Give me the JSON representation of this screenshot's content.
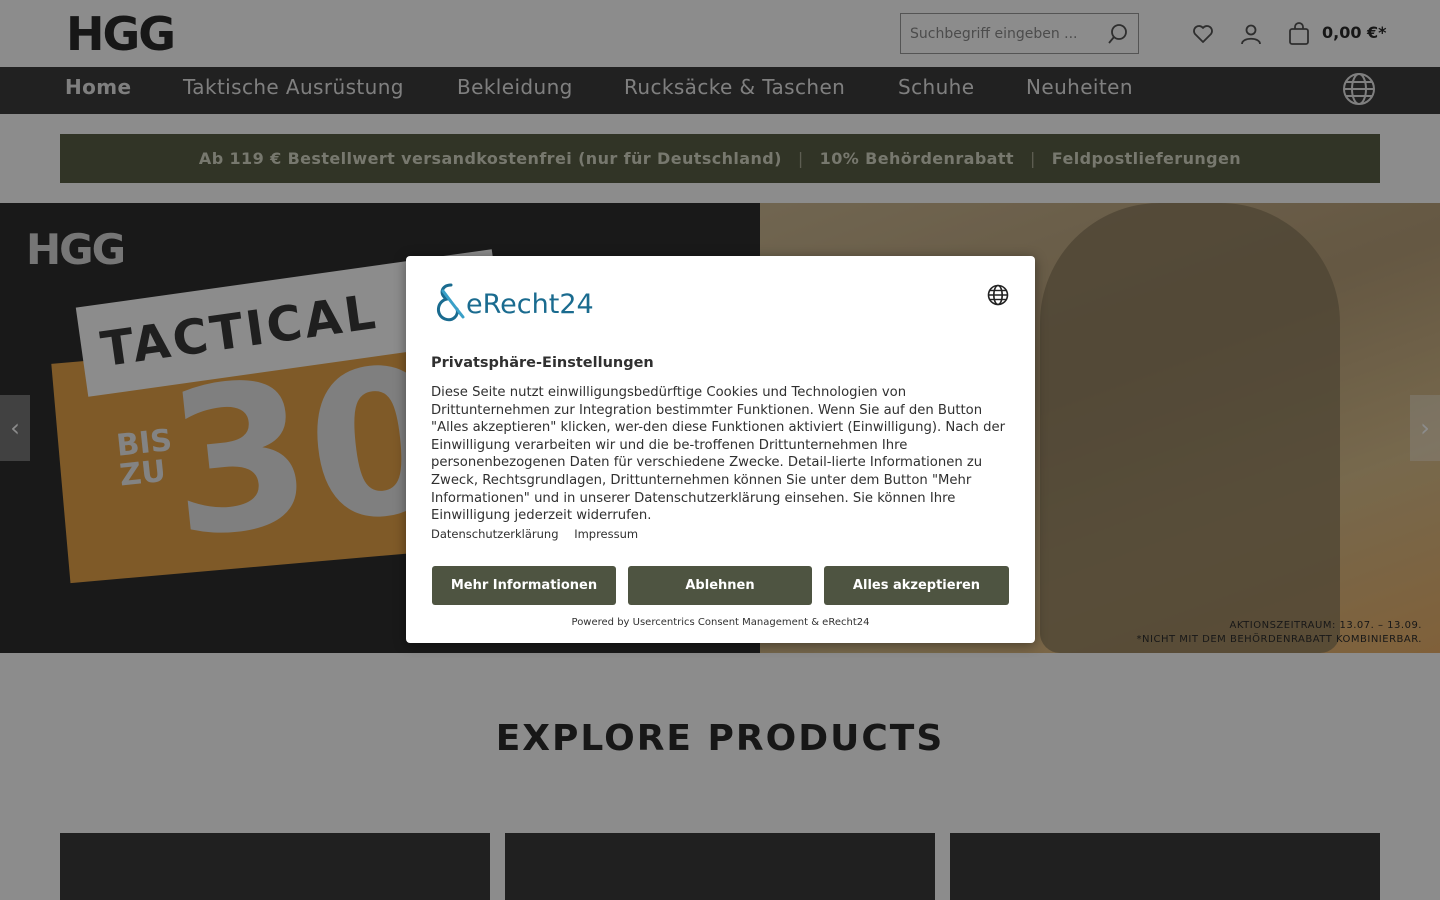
{
  "header": {
    "logo": "HGG",
    "search": {
      "placeholder": "Suchbegriff eingeben ..."
    },
    "icons": [
      "heart-icon",
      "user-icon",
      "shopping-bag-icon"
    ],
    "cart_total": "0,00 €*"
  },
  "nav": {
    "items": [
      {
        "label": "Home",
        "active": true
      },
      {
        "label": "Taktische Ausrüstung"
      },
      {
        "label": "Bekleidung"
      },
      {
        "label": "Rucksäcke & Taschen"
      },
      {
        "label": "Schuhe"
      },
      {
        "label": "Neuheiten"
      }
    ],
    "icon": "globe-icon"
  },
  "promo": {
    "items": [
      "Ab 119 € Bestellwert versandkostenfrei (nur für Deutschland)",
      "10% Behördenrabatt",
      "Feldpostlieferungen"
    ],
    "separator": "|"
  },
  "hero": {
    "logo": "HGG",
    "headline": "TACTICAL",
    "discount_prefix": "BIS ZU",
    "discount_visible": "30",
    "fine_print": [
      "AKTIONSZEITRAUM: 13.07. – 13.09.",
      "*NICHT MIT DEM BEHÖRDENRABATT KOMBINIERBAR."
    ],
    "prev_arrow": "‹",
    "next_arrow": "›"
  },
  "explore": {
    "title": "EXPLORE PRODUCTS"
  },
  "consent": {
    "brand": "eRecht24",
    "title": "Privatsphäre-Einstellungen",
    "body": "Diese Seite nutzt einwilligungsbedürftige Cookies und Technologien von Drittunternehmen zur Integration bestimmter Funktionen. Wenn Sie auf den Button \"Alles akzeptieren\" klicken, wer-den diese Funktionen aktiviert (Einwilligung). Nach der Einwilligung verarbeiten wir und die be-troffenen Drittunternehmen Ihre personenbezogenen Daten für verschiedene Zwecke. Detail-lierte Informationen zu Zweck, Rechtsgrundlagen, Drittunternehmen können Sie unter dem Button \"Mehr Informationen\" und in unserer Datenschutzerklärung einsehen. Sie können Ihre Einwilligung jederzeit widerrufen.",
    "links": [
      "Datenschutzerklärung",
      "Impressum"
    ],
    "buttons": {
      "more": "Mehr Informationen",
      "decline": "Ablehnen",
      "accept": "Alles akzeptieren"
    },
    "powered_by": "Powered by Usercentrics Consent Management & eRecht24"
  },
  "colors": {
    "nav_bg": "#3c3c3c",
    "promo_bg": "#5a5f45",
    "button_bg": "#4e5441",
    "brand_blue": "#1a6b8f"
  }
}
